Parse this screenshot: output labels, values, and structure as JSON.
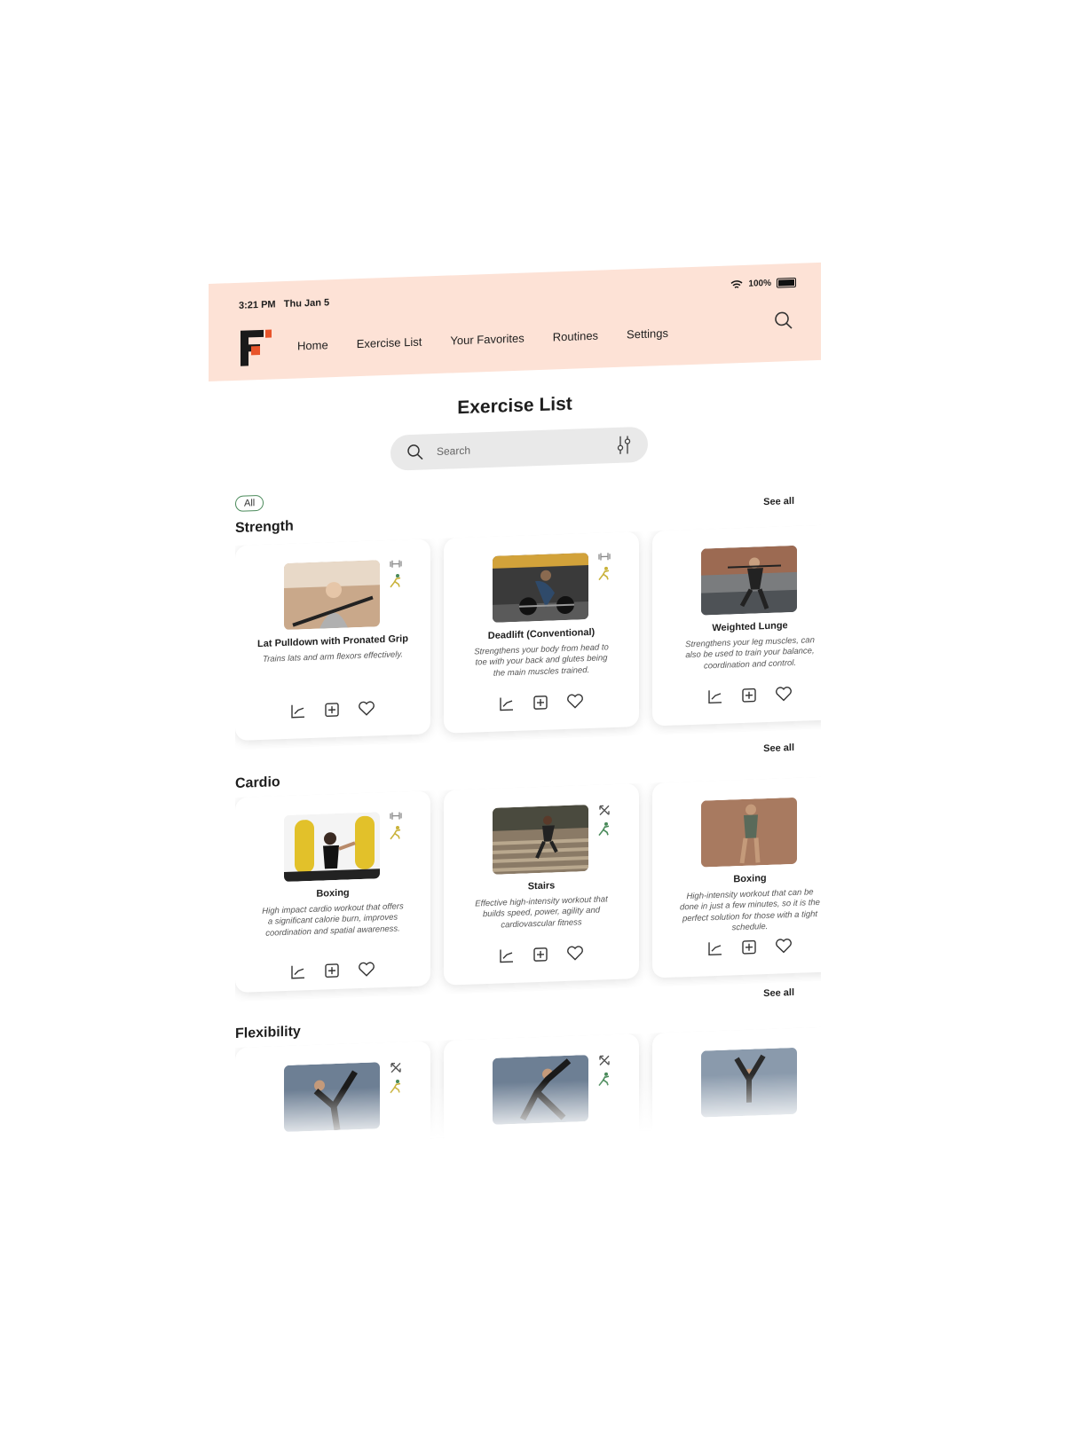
{
  "status": {
    "time": "3:21 PM",
    "date": "Thu Jan 5",
    "battery": "100%"
  },
  "nav": {
    "items": [
      "Home",
      "Exercise List",
      "Your Favorites",
      "Routines",
      "Settings"
    ]
  },
  "page": {
    "title": "Exercise List"
  },
  "search": {
    "placeholder": "Search"
  },
  "filter": {
    "chip": "All"
  },
  "sections": {
    "strength": {
      "title": "Strength",
      "see_all": "See all",
      "cards": [
        {
          "name": "Lat Pulldown with Pronated Grip",
          "desc": "Trains lats and arm flexors effectively."
        },
        {
          "name": "Deadlift (Conventional)",
          "desc": "Strengthens your body from head to toe with your back and glutes being the main muscles trained."
        },
        {
          "name": "Weighted Lunge",
          "desc": "Strengthens your leg muscles, can also be used to train your balance, coordination and control."
        }
      ]
    },
    "cardio": {
      "title": "Cardio",
      "see_all": "See all",
      "cards": [
        {
          "name": "Boxing",
          "desc": "High impact cardio workout that offers a significant calorie burn, improves coordination and spatial awareness."
        },
        {
          "name": "Stairs",
          "desc": "Effective high-intensity workout that builds speed, power, agility and cardiovascular fitness"
        },
        {
          "name": "Boxing",
          "desc": "High-intensity workout that can be done in just a few minutes, so it is the perfect solution for those with a tight schedule."
        }
      ]
    },
    "flexibility": {
      "title": "Flexibility",
      "see_all": "See all"
    }
  },
  "colors": {
    "header_bg": "#fde2d6",
    "accent_green": "#4a8a5a",
    "accent_yellow": "#c9b23a",
    "logo_orange": "#e8542a"
  }
}
